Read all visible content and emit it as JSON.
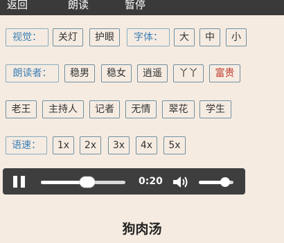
{
  "topbar": {
    "back_label": "返回",
    "read_label": "朗读",
    "pause_label": "暂停"
  },
  "visual": {
    "label": "视觉：",
    "options": [
      "关灯",
      "护眼",
      "字体：",
      "大",
      "中",
      "小"
    ]
  },
  "reader": {
    "label": "朗读者：",
    "row1": [
      "稳男",
      "稳女",
      "逍遥",
      "丫丫",
      "富贵"
    ],
    "row2": [
      "老王",
      "主持人",
      "记者",
      "无情",
      "翠花",
      "学生"
    ],
    "selected": "富贵"
  },
  "speed": {
    "label": "语速：",
    "options": [
      "1x",
      "2x",
      "3x",
      "4x",
      "5x"
    ]
  },
  "player": {
    "time": "0:20",
    "progress": 0.55,
    "volume": 0.75
  },
  "content": {
    "title": "狗肉汤"
  },
  "colors": {
    "label_text": "#3a7fb5",
    "selected_text": "#c0392b",
    "background": "#f5ebe1",
    "player_bg": "#3e3e3e"
  }
}
